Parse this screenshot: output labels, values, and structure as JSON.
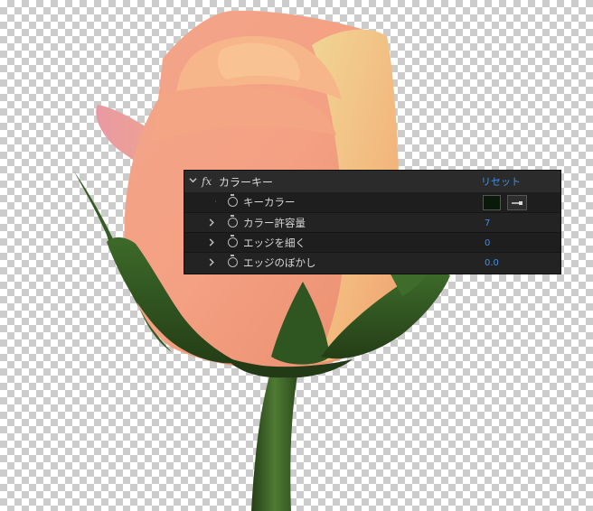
{
  "effect": {
    "fx_label": "fx",
    "name": "カラーキー",
    "reset_label": "リセット"
  },
  "properties": [
    {
      "label": "キーカラー",
      "value": "",
      "swatch_color": "#0a1a0a"
    },
    {
      "label": "カラー許容量",
      "value": "7"
    },
    {
      "label": "エッジを細く",
      "value": "0"
    },
    {
      "label": "エッジのぼかし",
      "value": "0.0"
    }
  ],
  "colors": {
    "accent": "#3f8ee6",
    "panel_bg": "#232323"
  }
}
